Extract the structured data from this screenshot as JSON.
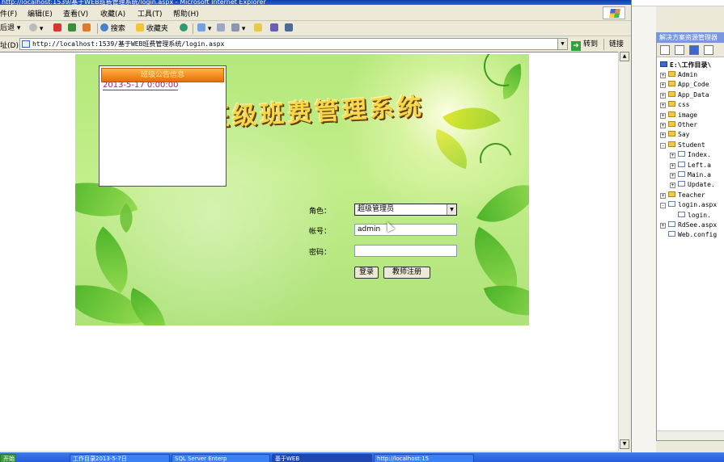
{
  "window": {
    "title": "http://localhost:1539/基于WEB班费管理系统/login.aspx - Microsoft Internet Explorer"
  },
  "menu": [
    "件(F)",
    "编辑(E)",
    "查看(V)",
    "收藏(A)",
    "工具(T)",
    "帮助(H)"
  ],
  "toolbar": {
    "back": "后退",
    "search": "搜索",
    "favorites": "收藏夹"
  },
  "address": {
    "label": "址(D)",
    "url": "http://localhost:1539/基于WEB班费管理系统/login.aspx",
    "go": "转到",
    "links": "链接"
  },
  "banner": {
    "title": "班级班费管理系统"
  },
  "notice": {
    "header": "班级公告信息",
    "item": "2013-5-17 0:00:00"
  },
  "form": {
    "role_label": "角色：",
    "role_value": "超级管理员",
    "account_label": "帐号：",
    "account_value": "admin",
    "password_label": "密码：",
    "password_value": "",
    "login_button": "登录",
    "register_button": "教师注册"
  },
  "solution_explorer": {
    "title": "解决方案资源管理器",
    "root": "E:\\工作目录\\",
    "items": [
      {
        "label": "Admin",
        "type": "folder",
        "expand": "+"
      },
      {
        "label": "App_Code",
        "type": "folder",
        "expand": "+"
      },
      {
        "label": "App_Data",
        "type": "folder",
        "expand": "+"
      },
      {
        "label": "css",
        "type": "folder",
        "expand": "+"
      },
      {
        "label": "image",
        "type": "folder",
        "expand": "+"
      },
      {
        "label": "Other",
        "type": "folder",
        "expand": "+"
      },
      {
        "label": "Say",
        "type": "folder",
        "expand": "+"
      },
      {
        "label": "Student",
        "type": "folder",
        "expand": "-"
      },
      {
        "label": "Index.",
        "type": "file",
        "expand": "+"
      },
      {
        "label": "Left.a",
        "type": "file",
        "expand": "+"
      },
      {
        "label": "Main.a",
        "type": "file",
        "expand": "+"
      },
      {
        "label": "Update.",
        "type": "file",
        "expand": "+"
      },
      {
        "label": "Teacher",
        "type": "folder",
        "expand": "+"
      },
      {
        "label": "login.aspx",
        "type": "file",
        "expand": "-"
      },
      {
        "label": "login.",
        "type": "file",
        "expand": ""
      },
      {
        "label": "RdSee.aspx",
        "type": "file",
        "expand": "+"
      },
      {
        "label": "Web.config",
        "type": "file",
        "expand": ""
      }
    ]
  },
  "taskbar": {
    "start": "开始",
    "tasks": [
      "工作目录2013-5-7日",
      "SQL Server Enterp",
      "基于WEB",
      "http://localhost:15"
    ]
  },
  "colors": {
    "banner_green": "#b3e87a",
    "notice_orange": "#e96e06",
    "notice_text": "#b31b6e",
    "title_blue": "#0a3fa8"
  }
}
